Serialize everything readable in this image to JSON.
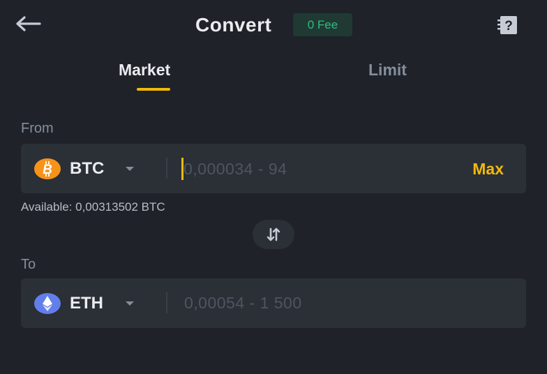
{
  "header": {
    "title": "Convert",
    "fee_badge": "0 Fee"
  },
  "tabs": [
    {
      "label": "Market",
      "active": true
    },
    {
      "label": "Limit",
      "active": false
    }
  ],
  "from": {
    "label": "From",
    "coin": "BTC",
    "coin_icon": "bitcoin-icon",
    "coin_color": "#f7931a",
    "placeholder": "0,000034 - 94",
    "value": "",
    "max_label": "Max",
    "available": "Available: 0,00313502 BTC"
  },
  "to": {
    "label": "To",
    "coin": "ETH",
    "coin_icon": "ethereum-icon",
    "coin_color": "#627eea",
    "placeholder": "0,00054 - 1 500",
    "value": ""
  },
  "colors": {
    "accent": "#f0b90b",
    "background": "#1f2229",
    "panel": "#2b2f36",
    "fee_green": "#2ebd85"
  }
}
